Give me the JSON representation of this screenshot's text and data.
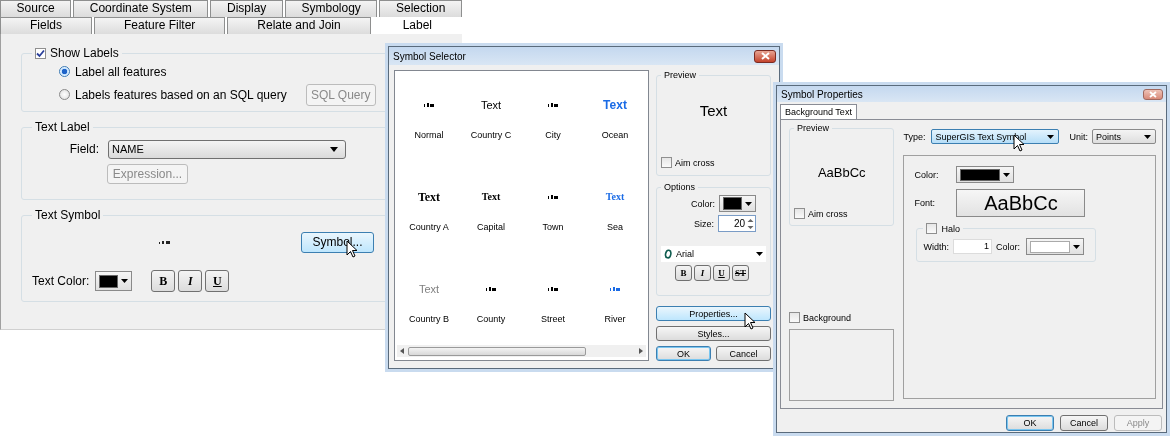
{
  "layer_properties": {
    "tabs_row_1": [
      {
        "label": "Source",
        "selected": false
      },
      {
        "label": "Coordinate System",
        "selected": false
      },
      {
        "label": "Display",
        "selected": false
      },
      {
        "label": "Symbology",
        "selected": false
      },
      {
        "label": "Selection",
        "selected": false
      }
    ],
    "tabs_row_2": [
      {
        "label": "Fields",
        "selected": false
      },
      {
        "label": "Feature Filter",
        "selected": false
      },
      {
        "label": "Relate and Join",
        "selected": false
      },
      {
        "label": "Label",
        "selected": true
      }
    ],
    "show_labels": {
      "label": "Show Labels",
      "checked": true
    },
    "label_options": [
      {
        "label": "Label all features",
        "selected": true
      },
      {
        "label": "Labels features based on an SQL query",
        "selected": false
      }
    ],
    "sql_query_button": {
      "label": "SQL Query",
      "disabled": true
    },
    "text_label": {
      "title": "Text Label",
      "field_label": "Field:",
      "field_value": "NAME",
      "expression_button": {
        "label": "Expression...",
        "disabled": true
      }
    },
    "text_symbol": {
      "title": "Text Symbol",
      "symbol_button": {
        "label": "Symbol...",
        "hovered": true
      },
      "text_color_label": "Text Color:",
      "style_buttons": [
        {
          "label": "B",
          "kind": "bold"
        },
        {
          "label": "I",
          "kind": "italic"
        },
        {
          "label": "U",
          "kind": "underline"
        }
      ]
    }
  },
  "symbol_selector": {
    "title": "Symbol Selector",
    "symbols": [
      {
        "name": "Normal",
        "kind": "tiny",
        "color": "#000000"
      },
      {
        "name": "Country C",
        "kind": "sans",
        "sample": "Text",
        "color": "#000000"
      },
      {
        "name": "City",
        "kind": "tiny",
        "color": "#000000"
      },
      {
        "name": "Ocean",
        "kind": "bold",
        "sample": "Text",
        "color": "#1a6be6"
      },
      {
        "name": "Country A",
        "kind": "serif",
        "sample": "Text",
        "color": "#000000"
      },
      {
        "name": "Capital",
        "kind": "small-serif",
        "sample": "Text",
        "color": "#000000"
      },
      {
        "name": "Town",
        "kind": "tiny",
        "color": "#000000"
      },
      {
        "name": "Sea",
        "kind": "small-serif",
        "sample": "Text",
        "color": "#1a6be6"
      },
      {
        "name": "Country B",
        "kind": "sans",
        "sample": "Text",
        "color": "#808080"
      },
      {
        "name": "County",
        "kind": "tiny",
        "color": "#000000"
      },
      {
        "name": "Street",
        "kind": "tiny",
        "color": "#000000"
      },
      {
        "name": "River",
        "kind": "tiny",
        "color": "#1a6be6"
      }
    ],
    "preview": {
      "title": "Preview",
      "sample": "Text",
      "aim_cross": {
        "label": "Aim cross",
        "checked": false
      }
    },
    "options": {
      "title": "Options",
      "color_label": "Color:",
      "size_label": "Size:",
      "size": "20",
      "font": "Arial",
      "style_buttons": [
        {
          "label": "B",
          "kind": "bold"
        },
        {
          "label": "I",
          "kind": "italic"
        },
        {
          "label": "U",
          "kind": "underline"
        },
        {
          "label": "ST",
          "kind": "strike"
        }
      ]
    },
    "buttons": [
      {
        "label": "Properties...",
        "hovered": true,
        "default": false
      },
      {
        "label": "Styles...",
        "hovered": false,
        "default": false
      },
      {
        "label": "OK",
        "hovered": false,
        "default": true
      },
      {
        "label": "Cancel",
        "hovered": false,
        "default": false
      }
    ]
  },
  "symbol_properties": {
    "title": "Symbol Properties",
    "tabs": [
      {
        "label": "Background Text",
        "selected": true
      }
    ],
    "preview": {
      "title": "Preview",
      "sample": "AaBbCc",
      "aim_cross": {
        "label": "Aim cross",
        "checked": false
      }
    },
    "background": {
      "label": "Background",
      "checked": false
    },
    "type_label": "Type:",
    "type_value": "SuperGIS Text Symbol",
    "unit_label": "Unit:",
    "unit_value": "Points",
    "color_label": "Color:",
    "font_label": "Font:",
    "font_sample": "AaBbCc",
    "halo": {
      "label": "Halo",
      "checked": false
    },
    "width_label": "Width:",
    "width_value": "1",
    "halo_color_label": "Color:",
    "buttons": [
      {
        "label": "OK",
        "disabled": false,
        "default": true
      },
      {
        "label": "Cancel",
        "disabled": false,
        "default": false
      },
      {
        "label": "Apply",
        "disabled": true,
        "default": false
      }
    ]
  }
}
